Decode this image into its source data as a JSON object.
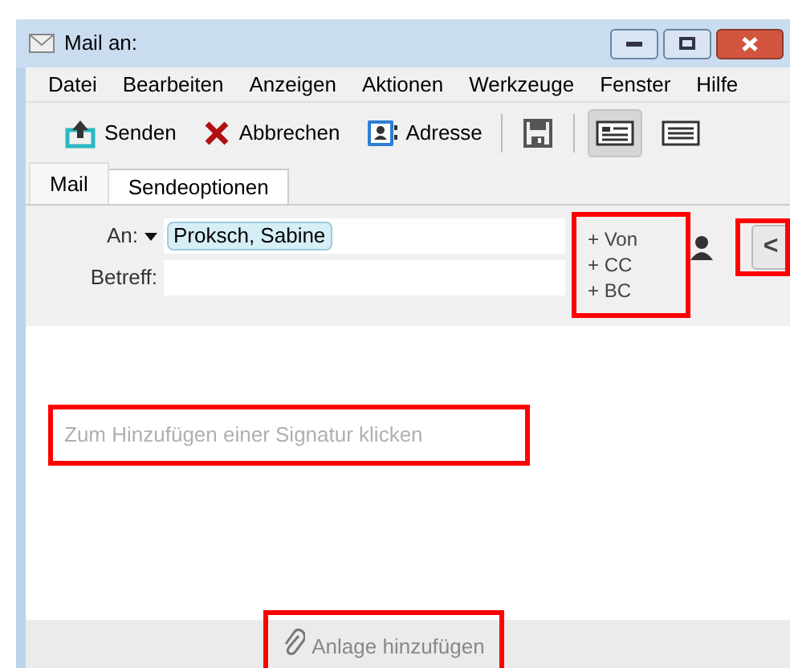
{
  "window": {
    "title": "Mail an:"
  },
  "menu": [
    "Datei",
    "Bearbeiten",
    "Anzeigen",
    "Aktionen",
    "Werkzeuge",
    "Fenster",
    "Hilfe"
  ],
  "toolbar": [
    {
      "kind": "send",
      "label": "Senden"
    },
    {
      "kind": "cancel",
      "label": "Abbrechen"
    },
    {
      "kind": "address",
      "label": "Adresse"
    },
    {
      "kind": "save"
    },
    {
      "kind": "layout1",
      "selected": true
    },
    {
      "kind": "layout2",
      "selected": false
    }
  ],
  "tabs": [
    {
      "label": "Mail",
      "selected": true
    },
    {
      "label": "Sendeoptionen",
      "selected": false
    }
  ],
  "header": {
    "to_label": "An:",
    "recipient": "Proksch, Sabine",
    "subject_label": "Betreff:",
    "add_fields": {
      "highlighted": true,
      "items": [
        "+ Von",
        "+ CC",
        "+ BC"
      ]
    },
    "collapse": {
      "label": "<",
      "highlighted": true
    }
  },
  "signature": {
    "text": "Zum Hinzufügen einer Signatur klicken",
    "highlighted": true
  },
  "attachment": {
    "text": "Anlage hinzufügen",
    "highlighted": true
  }
}
